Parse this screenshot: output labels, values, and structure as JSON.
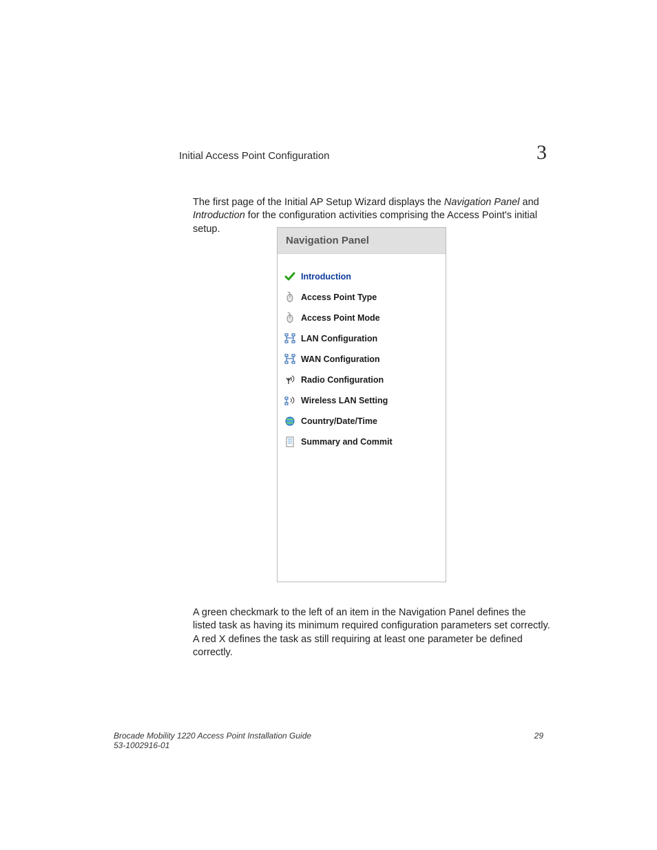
{
  "header": {
    "title": "Initial Access Point Configuration",
    "chapter": "3"
  },
  "intro": {
    "pre": "The first page of the Initial AP Setup Wizard displays the ",
    "em1": "Navigation Panel",
    "mid": " and ",
    "em2": "Introduction",
    "post": " for the configuration activities comprising the Access Point's initial setup."
  },
  "nav_panel": {
    "title": "Navigation Panel",
    "items": [
      {
        "label": "Introduction",
        "icon": "checkmark",
        "active": true
      },
      {
        "label": "Access Point Type",
        "icon": "mouse",
        "active": false
      },
      {
        "label": "Access Point Mode",
        "icon": "mouse",
        "active": false
      },
      {
        "label": "LAN Configuration",
        "icon": "lan",
        "active": false
      },
      {
        "label": "WAN Configuration",
        "icon": "lan",
        "active": false
      },
      {
        "label": "Radio Configuration",
        "icon": "antenna",
        "active": false
      },
      {
        "label": "Wireless LAN Setting",
        "icon": "wifi-lan",
        "active": false
      },
      {
        "label": "Country/Date/Time",
        "icon": "globe",
        "active": false
      },
      {
        "label": "Summary and Commit",
        "icon": "document",
        "active": false
      }
    ]
  },
  "outro": "A green checkmark to the left of an item in the Navigation Panel defines the listed task as having its minimum required configuration parameters set correctly. A red X defines the task as still requiring at least one parameter be defined correctly.",
  "footer": {
    "guide": "Brocade Mobility 1220 Access Point Installation Guide",
    "docnum": "53-1002916-01",
    "page": "29"
  }
}
